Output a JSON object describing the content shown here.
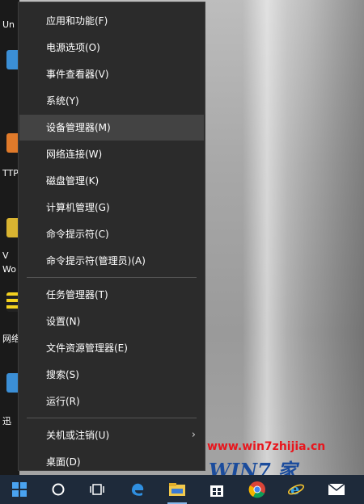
{
  "menu": {
    "items": [
      {
        "label": "应用和功能(F)"
      },
      {
        "label": "电源选项(O)"
      },
      {
        "label": "事件查看器(V)"
      },
      {
        "label": "系统(Y)"
      },
      {
        "label": "设备管理器(M)"
      },
      {
        "label": "网络连接(W)"
      },
      {
        "label": "磁盘管理(K)"
      },
      {
        "label": "计算机管理(G)"
      },
      {
        "label": "命令提示符(C)"
      },
      {
        "label": "命令提示符(管理员)(A)"
      },
      {
        "label": "任务管理器(T)"
      },
      {
        "label": "设置(N)"
      },
      {
        "label": "文件资源管理器(E)"
      },
      {
        "label": "搜索(S)"
      },
      {
        "label": "运行(R)"
      },
      {
        "label": "关机或注销(U)"
      },
      {
        "label": "桌面(D)"
      }
    ],
    "highlighted": "设备管理器(M)",
    "submenu_arrow": "›"
  },
  "desktop": {
    "labels": [
      "Un",
      "TTP",
      "V",
      "Wo",
      "网络",
      "迅"
    ]
  },
  "watermark": {
    "url": "www.win7zhijia.cn",
    "logo": "WIN7 家"
  },
  "taskbar": {
    "icons": [
      "windows-start-icon",
      "cortana-icon",
      "task-view-icon",
      "edge-icon",
      "file-explorer-icon",
      "store-icon",
      "chrome-icon",
      "ie-icon",
      "mail-icon"
    ]
  },
  "colors": {
    "menu_bg": "#2b2b2b",
    "menu_highlight": "#434343",
    "taskbar_bg": "#1e2a3a",
    "watermark_red": "#e8161d",
    "watermark_blue": "#1b4c9c"
  }
}
